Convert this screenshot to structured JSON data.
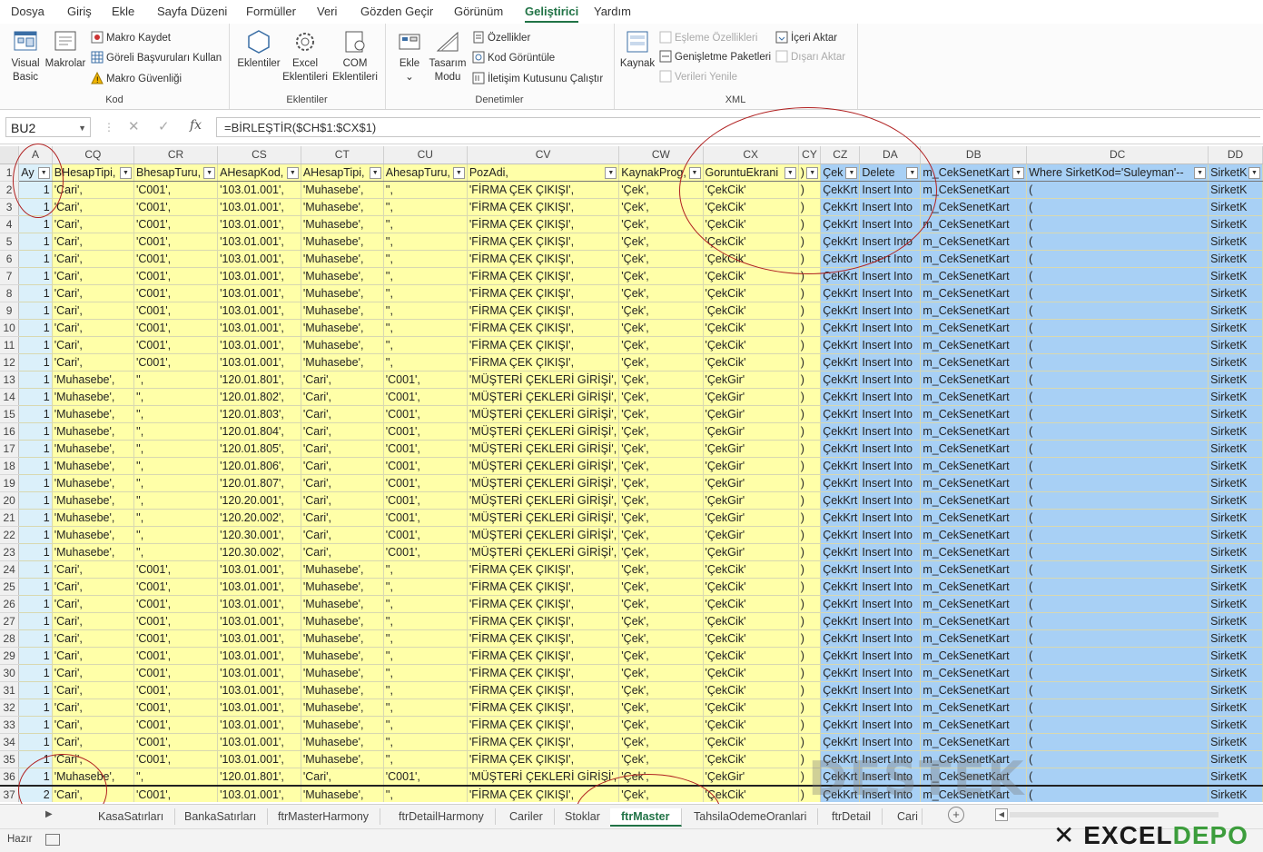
{
  "menu": [
    "Dosya",
    "Giriş",
    "Ekle",
    "Sayfa Düzeni",
    "Formüller",
    "Veri",
    "Gözden Geçir",
    "Görünüm",
    "Geliştirici",
    "Yardım"
  ],
  "ribbon": {
    "kod": {
      "label": "Kod",
      "visual_basic": "Visual Basic",
      "makrolar": "Makrolar",
      "makro_kaydet": "Makro Kaydet",
      "goreli": "Göreli Başvuruları Kullan",
      "makro_guvenligi": "Makro Güvenliği"
    },
    "eklentiler": {
      "label": "Eklentiler",
      "eklentiler": "Eklentiler",
      "excel_eklentileri": "Excel Eklentileri",
      "com_eklentileri": "COM Eklentileri"
    },
    "denetimler": {
      "label": "Denetimler",
      "ekle": "Ekle",
      "tasarim_modu": "Tasarım Modu",
      "ozellikler": "Özellikler",
      "kod_goruntule": "Kod Görüntüle",
      "iletisim": "İletişim Kutusunu Çalıştır"
    },
    "xml": {
      "label": "XML",
      "kaynak": "Kaynak",
      "esleme": "Eşleme Özellikleri",
      "genisletme": "Genişletme Paketleri",
      "verileri_yenile": "Verileri Yenile",
      "iceri_aktar": "İçeri Aktar",
      "disari_aktar": "Dışarı Aktar"
    }
  },
  "formula_bar": {
    "name_box": "BU2",
    "formula": "=BİRLEŞTİR($CH$1:$CX$1)"
  },
  "columns": [
    "A",
    "CQ",
    "CR",
    "CS",
    "CT",
    "CU",
    "CV",
    "CW",
    "CX",
    "CY",
    "CZ",
    "DA",
    "DB",
    "DC",
    "DD"
  ],
  "header_row": [
    "Ay",
    "BHesapTipi,",
    "BhesapTuru,",
    "AHesapKod,",
    "AHesapTipi,",
    "AhesapTuru,",
    "PozAdi,",
    "KaynakProg,",
    "GoruntuEkrani",
    ")",
    "Çek",
    "Delete",
    "m_CekSenetKart",
    "Where SirketKod='Suleyman'--",
    "SirketK"
  ],
  "row_templates": {
    "cik": [
      "1",
      "'Cari',",
      "'C001',",
      "'103.01.001',",
      "'Muhasebe',",
      "'',",
      "'FİRMA ÇEK ÇIKIŞI',",
      "'Çek',",
      "'ÇekCik'",
      ")",
      "ÇekKrt",
      "Insert Into",
      "m_CekSenetKart",
      "(",
      "SirketK"
    ],
    "gir": [
      "1",
      "'Muhasebe',",
      "'',",
      "{kod}",
      "'Cari',",
      "'C001',",
      "'MÜŞTERİ ÇEKLERİ GİRİŞİ',",
      "'Çek',",
      "'ÇekGir'",
      ")",
      "ÇekKrt",
      "Insert Into",
      "m_CekSenetKart",
      "(",
      "SirketK"
    ]
  },
  "rows": [
    {
      "n": "2",
      "t": "cik"
    },
    {
      "n": "3",
      "t": "cik"
    },
    {
      "n": "4",
      "t": "cik"
    },
    {
      "n": "5",
      "t": "cik"
    },
    {
      "n": "6",
      "t": "cik"
    },
    {
      "n": "7",
      "t": "cik"
    },
    {
      "n": "8",
      "t": "cik"
    },
    {
      "n": "9",
      "t": "cik"
    },
    {
      "n": "10",
      "t": "cik"
    },
    {
      "n": "11",
      "t": "cik"
    },
    {
      "n": "12",
      "t": "cik"
    },
    {
      "n": "13",
      "t": "gir",
      "kod": "'120.01.801',"
    },
    {
      "n": "14",
      "t": "gir",
      "kod": "'120.01.802',"
    },
    {
      "n": "15",
      "t": "gir",
      "kod": "'120.01.803',"
    },
    {
      "n": "16",
      "t": "gir",
      "kod": "'120.01.804',"
    },
    {
      "n": "17",
      "t": "gir",
      "kod": "'120.01.805',"
    },
    {
      "n": "18",
      "t": "gir",
      "kod": "'120.01.806',"
    },
    {
      "n": "19",
      "t": "gir",
      "kod": "'120.01.807',"
    },
    {
      "n": "20",
      "t": "gir",
      "kod": "'120.20.001',"
    },
    {
      "n": "21",
      "t": "gir",
      "kod": "'120.20.002',"
    },
    {
      "n": "22",
      "t": "gir",
      "kod": "'120.30.001',"
    },
    {
      "n": "23",
      "t": "gir",
      "kod": "'120.30.002',"
    },
    {
      "n": "24",
      "t": "cik"
    },
    {
      "n": "25",
      "t": "cik"
    },
    {
      "n": "26",
      "t": "cik"
    },
    {
      "n": "27",
      "t": "cik"
    },
    {
      "n": "28",
      "t": "cik"
    },
    {
      "n": "29",
      "t": "cik"
    },
    {
      "n": "30",
      "t": "cik"
    },
    {
      "n": "31",
      "t": "cik"
    },
    {
      "n": "32",
      "t": "cik"
    },
    {
      "n": "33",
      "t": "cik"
    },
    {
      "n": "34",
      "t": "cik"
    },
    {
      "n": "35",
      "t": "cik"
    },
    {
      "n": "36",
      "t": "gir",
      "kod": "'120.01.801',"
    },
    {
      "n": "37",
      "t": "cik",
      "ay": "2"
    }
  ],
  "sheet_tabs": [
    "KasaSatırları",
    "BankaSatırları",
    "ftrMasterHarmony",
    "ftrDetailHarmony",
    "Cariler",
    "Stoklar",
    "ftrMaster",
    "TahsilaOdemeOranlari",
    "ftrDetail",
    "Cari"
  ],
  "active_tab": "ftrMaster",
  "status": {
    "ready": "Hazır"
  },
  "watermark": "DESTEK",
  "logo": {
    "main": "EXCEL",
    "accent": "DEPO"
  },
  "colors": {
    "accent": "#217346",
    "yellow": "#ffffa8",
    "blue": "#a8d0f5",
    "lightblue": "#dbf0fa",
    "annotation": "#b02020"
  }
}
